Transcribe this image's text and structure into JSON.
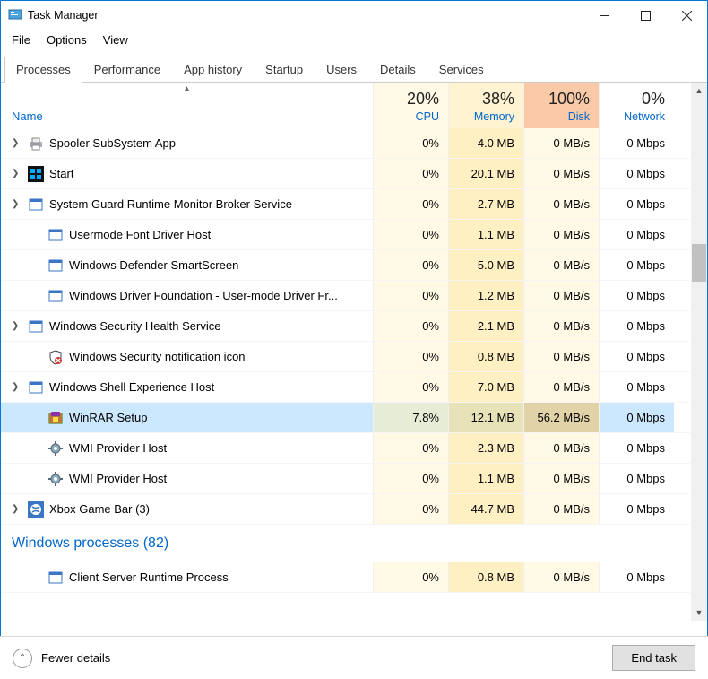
{
  "window": {
    "title": "Task Manager"
  },
  "menus": [
    "File",
    "Options",
    "View"
  ],
  "tabs": [
    {
      "label": "Processes",
      "active": true
    },
    {
      "label": "Performance",
      "active": false
    },
    {
      "label": "App history",
      "active": false
    },
    {
      "label": "Startup",
      "active": false
    },
    {
      "label": "Users",
      "active": false
    },
    {
      "label": "Details",
      "active": false
    },
    {
      "label": "Services",
      "active": false
    }
  ],
  "columns": {
    "name": "Name",
    "cpu": {
      "pct": "20%",
      "label": "CPU"
    },
    "memory": {
      "pct": "38%",
      "label": "Memory"
    },
    "disk": {
      "pct": "100%",
      "label": "Disk"
    },
    "network": {
      "pct": "0%",
      "label": "Network"
    }
  },
  "processes": [
    {
      "name": "Spooler SubSystem App",
      "cpu": "0%",
      "memory": "4.0 MB",
      "disk": "0 MB/s",
      "network": "0 Mbps",
      "expandable": true,
      "indent": 0,
      "icon": "printer",
      "selected": false
    },
    {
      "name": "Start",
      "cpu": "0%",
      "memory": "20.1 MB",
      "disk": "0 MB/s",
      "network": "0 Mbps",
      "expandable": true,
      "indent": 0,
      "icon": "start",
      "selected": false
    },
    {
      "name": "System Guard Runtime Monitor Broker Service",
      "cpu": "0%",
      "memory": "2.7 MB",
      "disk": "0 MB/s",
      "network": "0 Mbps",
      "expandable": true,
      "indent": 0,
      "icon": "window",
      "selected": false
    },
    {
      "name": "Usermode Font Driver Host",
      "cpu": "0%",
      "memory": "1.1 MB",
      "disk": "0 MB/s",
      "network": "0 Mbps",
      "expandable": false,
      "indent": 1,
      "icon": "window",
      "selected": false
    },
    {
      "name": "Windows Defender SmartScreen",
      "cpu": "0%",
      "memory": "5.0 MB",
      "disk": "0 MB/s",
      "network": "0 Mbps",
      "expandable": false,
      "indent": 1,
      "icon": "window",
      "selected": false
    },
    {
      "name": "Windows Driver Foundation - User-mode Driver Fr...",
      "cpu": "0%",
      "memory": "1.2 MB",
      "disk": "0 MB/s",
      "network": "0 Mbps",
      "expandable": false,
      "indent": 1,
      "icon": "window",
      "selected": false
    },
    {
      "name": "Windows Security Health Service",
      "cpu": "0%",
      "memory": "2.1 MB",
      "disk": "0 MB/s",
      "network": "0 Mbps",
      "expandable": true,
      "indent": 0,
      "icon": "window",
      "selected": false
    },
    {
      "name": "Windows Security notification icon",
      "cpu": "0%",
      "memory": "0.8 MB",
      "disk": "0 MB/s",
      "network": "0 Mbps",
      "expandable": false,
      "indent": 1,
      "icon": "shield",
      "selected": false
    },
    {
      "name": "Windows Shell Experience Host",
      "cpu": "0%",
      "memory": "7.0 MB",
      "disk": "0 MB/s",
      "network": "0 Mbps",
      "expandable": true,
      "indent": 0,
      "icon": "window",
      "selected": false
    },
    {
      "name": "WinRAR Setup",
      "cpu": "7.8%",
      "memory": "12.1 MB",
      "disk": "56.2 MB/s",
      "network": "0 Mbps",
      "expandable": false,
      "indent": 1,
      "icon": "winrar",
      "selected": true
    },
    {
      "name": "WMI Provider Host",
      "cpu": "0%",
      "memory": "2.3 MB",
      "disk": "0 MB/s",
      "network": "0 Mbps",
      "expandable": false,
      "indent": 1,
      "icon": "gear",
      "selected": false
    },
    {
      "name": "WMI Provider Host",
      "cpu": "0%",
      "memory": "1.1 MB",
      "disk": "0 MB/s",
      "network": "0 Mbps",
      "expandable": false,
      "indent": 1,
      "icon": "gear",
      "selected": false
    },
    {
      "name": "Xbox Game Bar (3)",
      "cpu": "0%",
      "memory": "44.7 MB",
      "disk": "0 MB/s",
      "network": "0 Mbps",
      "expandable": true,
      "indent": 0,
      "icon": "xbox",
      "selected": false
    }
  ],
  "group": {
    "label": "Windows processes (82)"
  },
  "group_processes": [
    {
      "name": "Client Server Runtime Process",
      "cpu": "0%",
      "memory": "0.8 MB",
      "disk": "0 MB/s",
      "network": "0 Mbps",
      "expandable": false,
      "indent": 1,
      "icon": "window",
      "selected": false
    }
  ],
  "footer": {
    "fewer": "Fewer details",
    "endtask": "End task"
  }
}
